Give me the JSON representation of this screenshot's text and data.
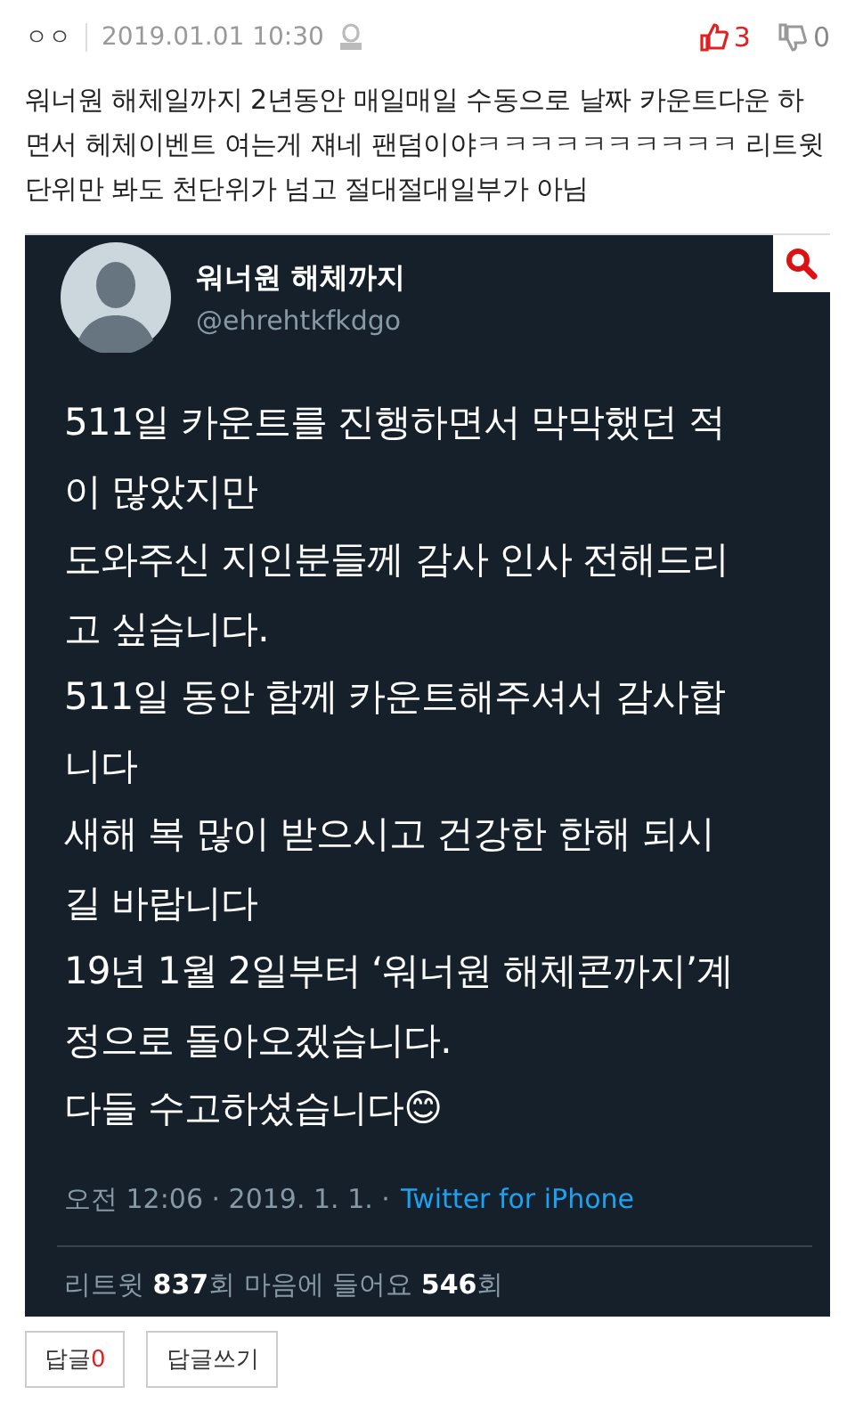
{
  "comment": {
    "author": "ㅇㅇ",
    "date": "2019.01.01 10:30",
    "likes": "3",
    "dislikes": "0",
    "text": "워너원 해체일까지 2년동안 매일매일 수동으로 날짜 카운트다운 하면서 헤체이벤트 여는게 쟤네 팬덤이야ㅋㅋㅋㅋㅋㅋㅋㅋㅋㅋ 리트윗 단위만 봐도 천단위가 넘고 절대절대일부가 아님"
  },
  "tweet": {
    "name": "워너원 해체까지",
    "handle": "@ehrehtkfkdgo",
    "lines": [
      "511일 카운트를 진행하면서 막막했던 적",
      "이 많았지만",
      "도와주신 지인분들께 감사 인사 전해드리",
      "고 싶습니다.",
      "511일 동안 함께 카운트해주셔서 감사합",
      "니다",
      "새해 복 많이 받으시고 건강한 한해 되시",
      "길 바랍니다",
      "19년 1월 2일부터 ‘워너원 해체콘까지’계",
      "정으로 돌아오겠습니다.",
      "다들 수고하셨습니다😊"
    ],
    "meta": "오전 12:06 · 2019. 1. 1. ·",
    "source": "Twitter for iPhone",
    "stats": "리트윗 **837**회  마음에 들어요 **546**회"
  },
  "buttons": [
    {
      "label": "답글",
      "count": "0"
    },
    {
      "label": "답글쓰기"
    }
  ]
}
